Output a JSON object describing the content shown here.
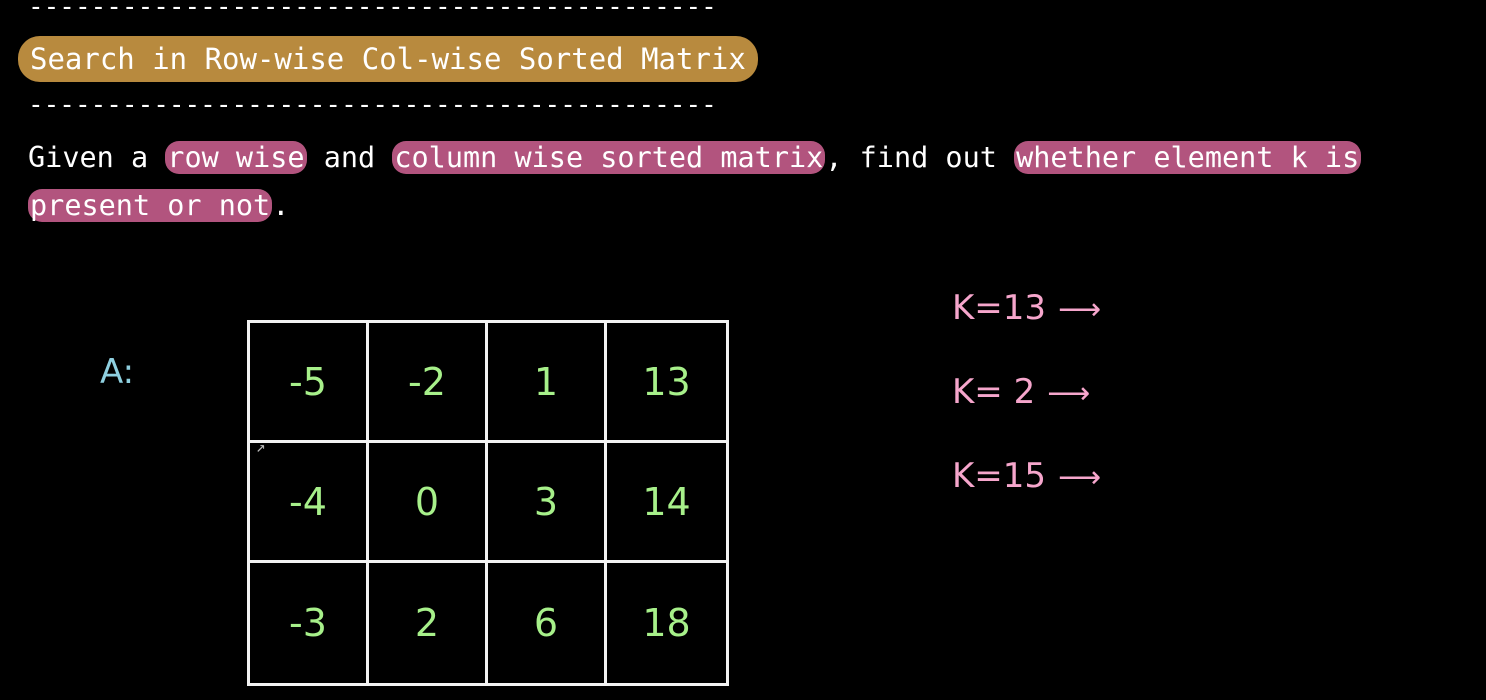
{
  "header": {
    "dashes": "--------------------------------------------",
    "title": "Search in Row-wise Col-wise Sorted Matrix"
  },
  "problem": {
    "p1": "Given a ",
    "h1": "row wise",
    "p2": " and ",
    "h2": "column wise sorted matrix",
    "p3": ", find out ",
    "h3": "whether element k is",
    "h4": "present or not",
    "p4": "."
  },
  "matrix": {
    "label": "A:",
    "rows": [
      [
        "-5",
        "-2",
        "1",
        "13"
      ],
      [
        "-4",
        "0",
        "3",
        "14"
      ],
      [
        "-3",
        "2",
        "6",
        "18"
      ]
    ]
  },
  "queries": [
    {
      "text": "K=13",
      "arrow": "⟶"
    },
    {
      "text": "K= 2",
      "arrow": "⟶"
    },
    {
      "text": "K=15",
      "arrow": "⟶"
    }
  ],
  "colors": {
    "title_highlight": "#b88a3e",
    "text_highlight": "#b2547e",
    "matrix_values": "#a7f08a",
    "matrix_label": "#8fd0e0",
    "queries": "#f6a6cc",
    "grid_lines": "#f2f2f2"
  }
}
